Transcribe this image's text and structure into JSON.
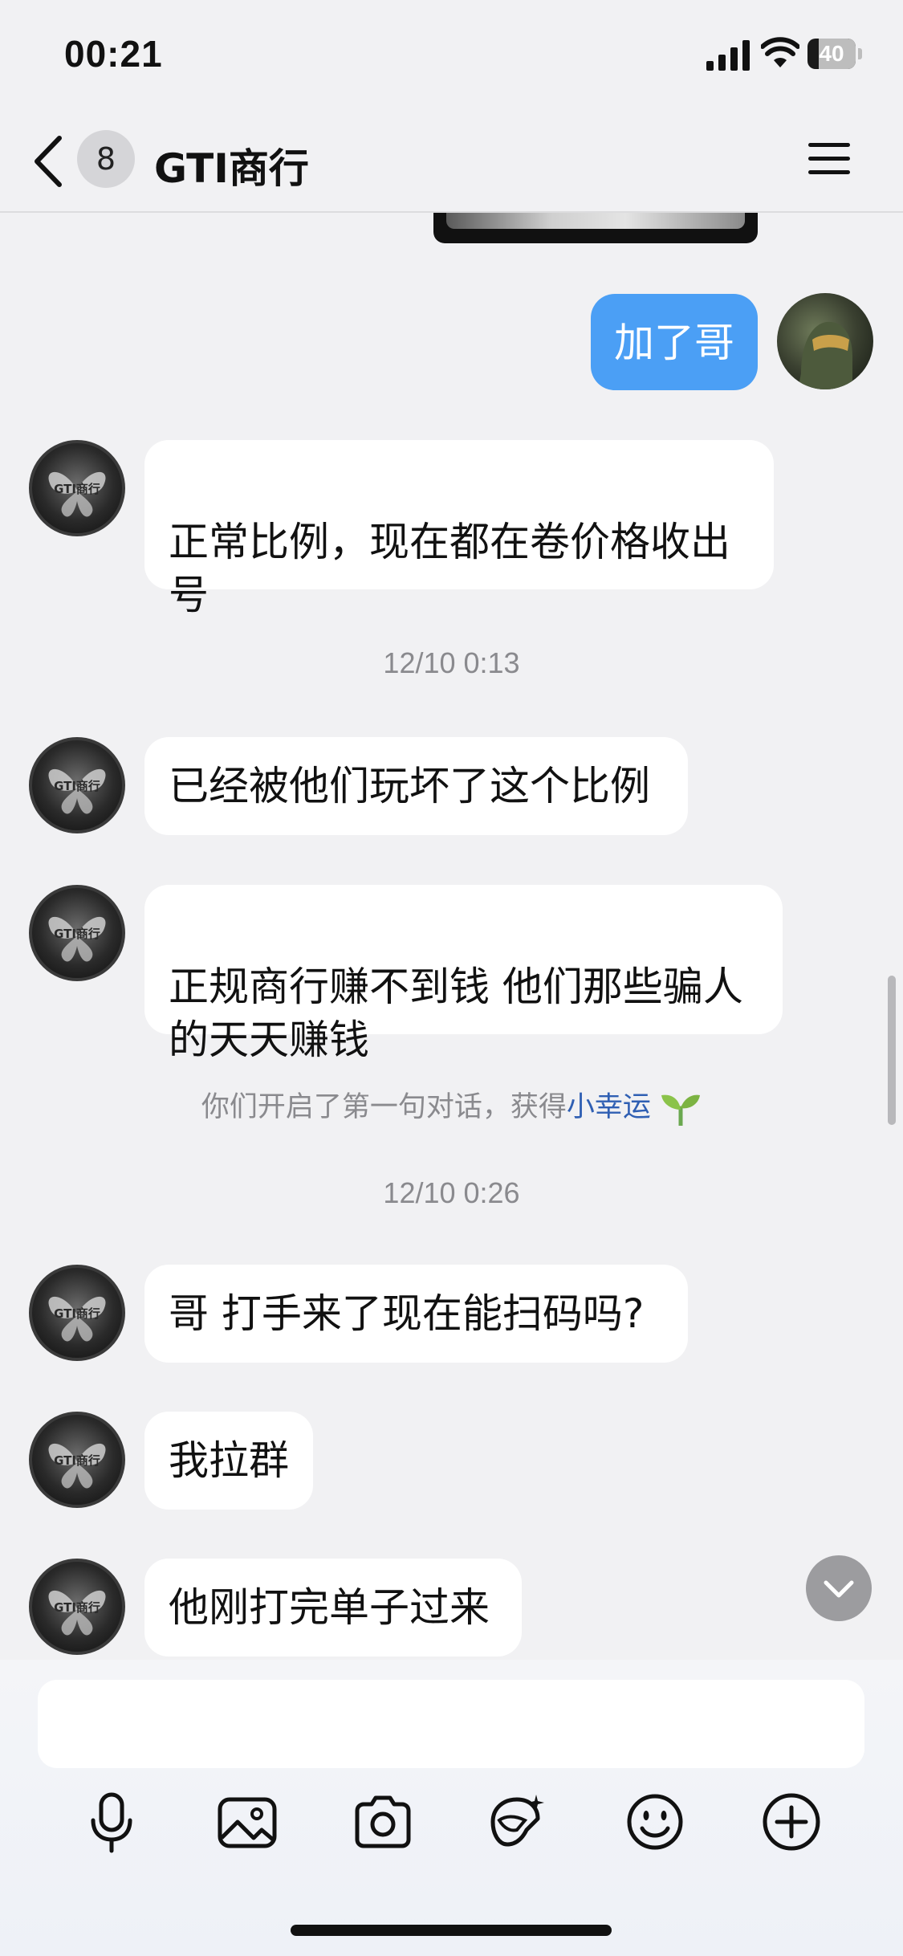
{
  "status_bar": {
    "time": "00:21",
    "battery": "40"
  },
  "nav": {
    "back_icon": "chevron-left-icon",
    "unread_count": "8",
    "title": "GTI商行",
    "menu_icon": "hamburger-menu-icon"
  },
  "messages": [
    {
      "sender": "me",
      "text": "加了哥"
    },
    {
      "sender": "GTI商行",
      "text": "正常比例，现在都在卷价格收出\n号"
    },
    {
      "type": "timestamp",
      "text": "12/10 0:13"
    },
    {
      "sender": "GTI商行",
      "text": "已经被他们玩坏了这个比例"
    },
    {
      "sender": "GTI商行",
      "text": "正规商行赚不到钱 他们那些骗人\n的天天赚钱"
    },
    {
      "type": "system",
      "text": "你们开启了第一句对话，获得",
      "link": "小幸运",
      "icon": "sprout-icon"
    },
    {
      "type": "timestamp",
      "text": "12/10 0:26"
    },
    {
      "sender": "GTI商行",
      "text": "哥 打手来了现在能扫码吗?"
    },
    {
      "sender": "GTI商行",
      "text": "我拉群"
    },
    {
      "sender": "GTI商行",
      "text": "他刚打完单子过来"
    }
  ],
  "avatar_badge_text": "GTI商行",
  "input": {
    "value": "",
    "placeholder": ""
  },
  "toolbar": [
    "microphone-icon",
    "image-icon",
    "camera-icon",
    "sticker-icon",
    "emoji-icon",
    "plus-icon"
  ],
  "colors": {
    "my_bubble": "#4b9ff5",
    "their_bubble": "#ffffff",
    "link": "#2f5fb3",
    "background": "#f1f1f3"
  }
}
